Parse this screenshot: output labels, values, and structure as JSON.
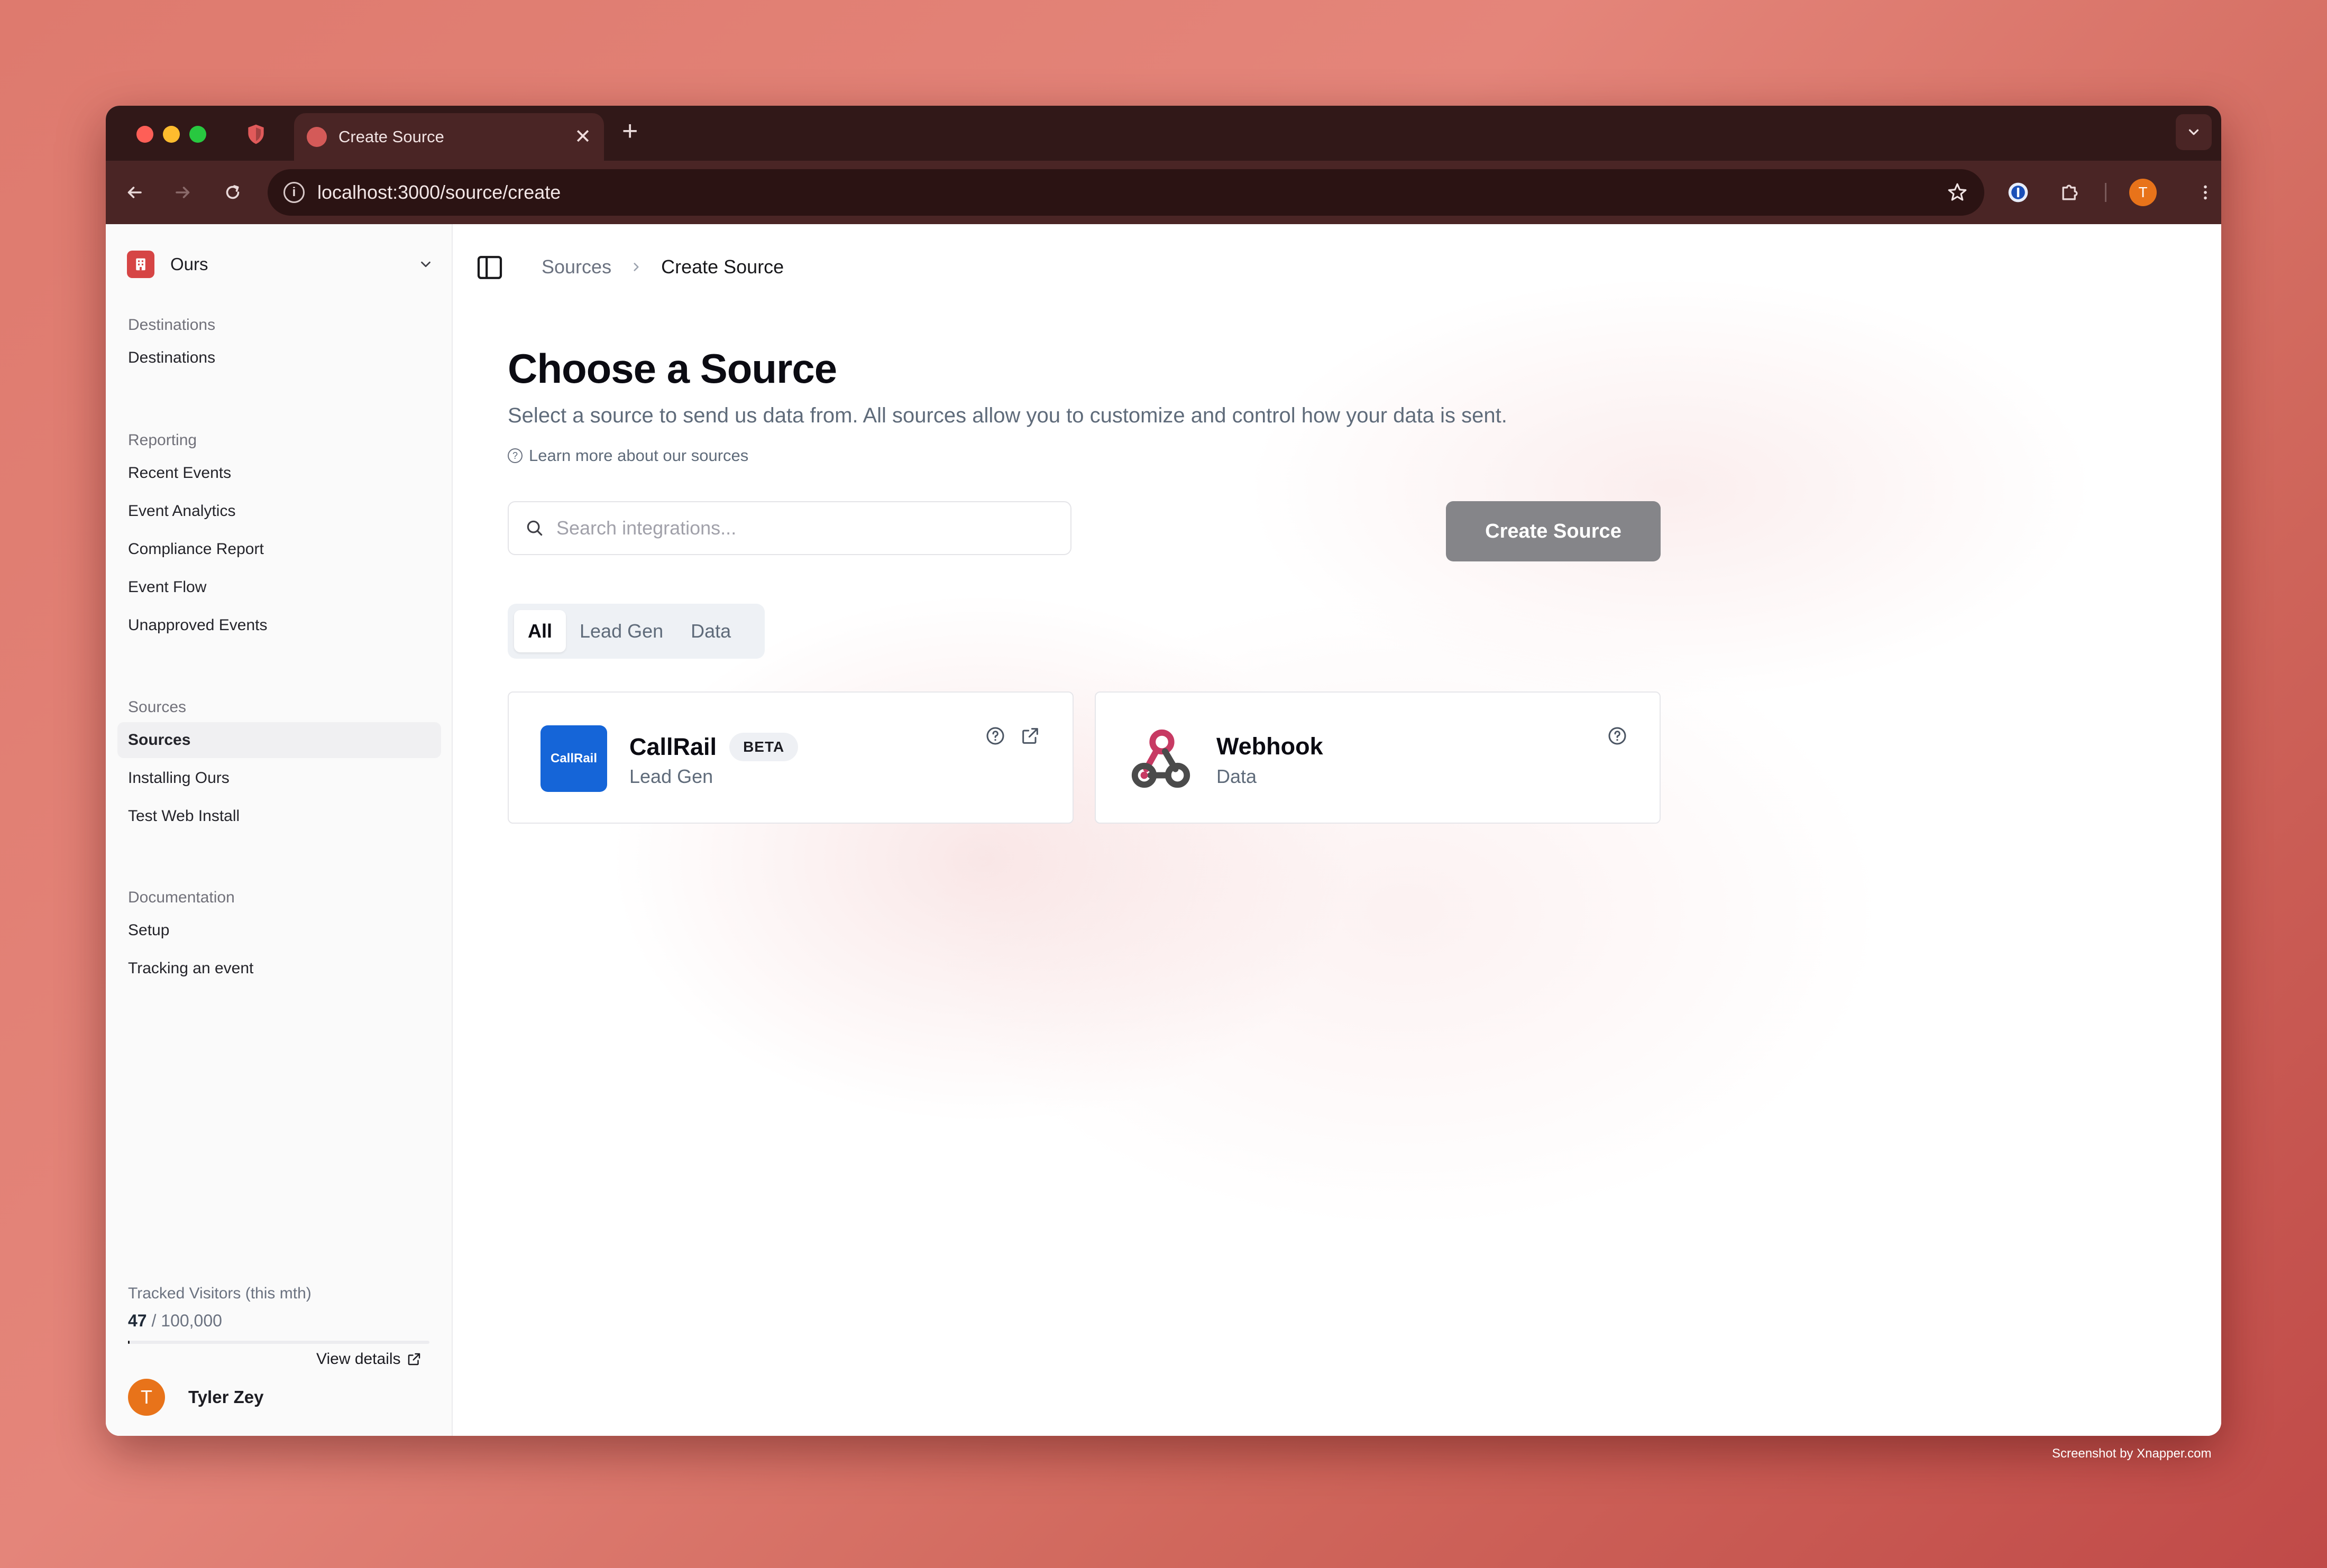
{
  "browser": {
    "tab_title": "Create Source",
    "url": "localhost:3000/source/create",
    "profile_initial": "T"
  },
  "sidebar": {
    "workspace": "Ours",
    "sections": [
      {
        "title": "Destinations",
        "items": [
          "Destinations"
        ]
      },
      {
        "title": "Reporting",
        "items": [
          "Recent Events",
          "Event Analytics",
          "Compliance Report",
          "Event Flow",
          "Unapproved Events"
        ]
      },
      {
        "title": "Sources",
        "items": [
          "Sources",
          "Installing Ours",
          "Test Web Install"
        ]
      },
      {
        "title": "Documentation",
        "items": [
          "Setup",
          "Tracking an event"
        ]
      }
    ],
    "active_item": "Sources",
    "usage": {
      "label": "Tracked Visitors (this mth)",
      "used": "47",
      "limit": "/ 100,000",
      "fraction": 0.00047,
      "view_details": "View details"
    },
    "user": {
      "initial": "T",
      "name": "Tyler Zey"
    }
  },
  "breadcrumb": {
    "parent": "Sources",
    "current": "Create Source"
  },
  "main": {
    "title": "Choose a Source",
    "subtitle": "Select a source to send us data from. All sources allow you to customize and control how your data is sent.",
    "learn_more": "Learn more about our sources",
    "search_placeholder": "Search integrations...",
    "create_button": "Create Source",
    "filter_tabs": [
      "All",
      "Lead Gen",
      "Data"
    ],
    "active_filter": "All"
  },
  "sources": [
    {
      "name": "CallRail",
      "badge": "BETA",
      "category": "Lead Gen",
      "logo_text": "CallRail",
      "color": "#1565d8"
    },
    {
      "name": "Webhook",
      "category": "Data"
    }
  ],
  "footer_credit": "Screenshot by Xnapper.com",
  "colors": {
    "accent_red": "#d64545",
    "avatar_orange": "#e8731a",
    "button_gray": "#858589"
  }
}
